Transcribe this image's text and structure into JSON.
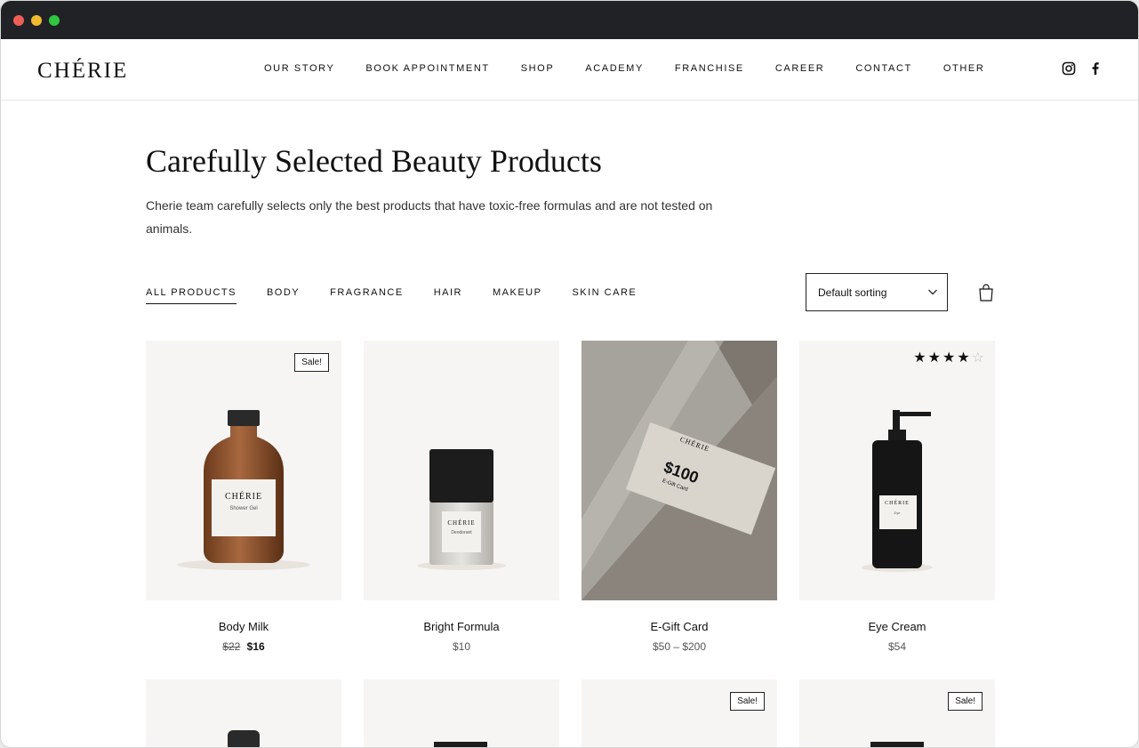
{
  "brand": {
    "logo": "CHÉRIE"
  },
  "nav": [
    "OUR STORY",
    "BOOK APPOINTMENT",
    "SHOP",
    "ACADEMY",
    "FRANCHISE",
    "CAREER",
    "CONTACT",
    "OTHER"
  ],
  "social": [
    "instagram-icon",
    "facebook-icon"
  ],
  "page": {
    "title": "Carefully Selected Beauty Products",
    "intro": "Cherie team carefully selects only the best products that have toxic-free formulas and are not tested on animals."
  },
  "filters": [
    "ALL PRODUCTS",
    "BODY",
    "FRAGRANCE",
    "HAIR",
    "MAKEUP",
    "SKIN CARE"
  ],
  "active_filter": "ALL PRODUCTS",
  "sorting": {
    "selected": "Default sorting"
  },
  "products": [
    {
      "name": "Body Milk",
      "old_price": "$22",
      "price": "$16",
      "badge": "Sale!"
    },
    {
      "name": "Bright Formula",
      "price": "$10"
    },
    {
      "name": "E-Gift Card",
      "price": "$50 – $200",
      "card_label": "CHÉRIE",
      "card_value": "$100",
      "card_caption": "E-Gift Card"
    },
    {
      "name": "Eye Cream",
      "price": "$54",
      "rating": 4,
      "rating_max": 5
    }
  ],
  "products_row2": [
    {
      "badge": ""
    },
    {
      "badge": ""
    },
    {
      "badge": "Sale!"
    },
    {
      "badge": "Sale!"
    }
  ],
  "labels": {
    "p1_brand": "CHÉRIE",
    "p1_sub": "Shower Gel",
    "p2_brand": "CHÉRIE",
    "p2_sub": "Deodorant",
    "p4_brand": "CHÉRIE",
    "p4_sub": "Eye"
  },
  "colors": {
    "accent": "#111111",
    "card_bg": "#f7f5f3",
    "titlebar": "#212226"
  }
}
